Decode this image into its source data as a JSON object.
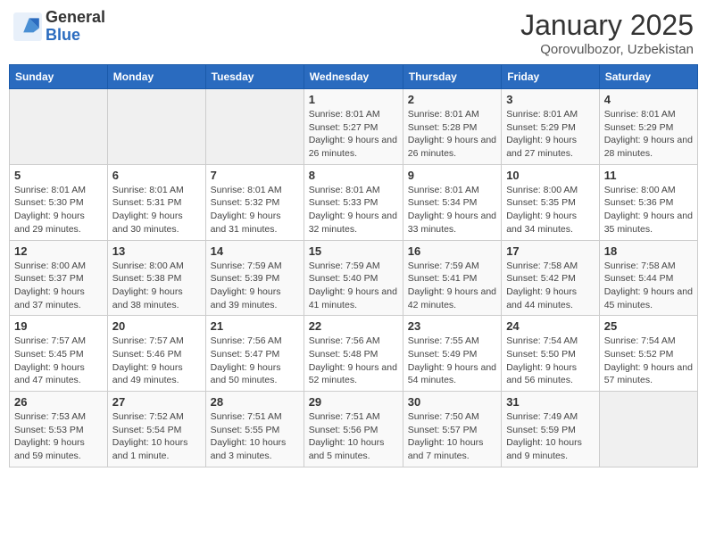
{
  "header": {
    "logo_general": "General",
    "logo_blue": "Blue",
    "month": "January 2025",
    "location": "Qorovulbozor, Uzbekistan"
  },
  "weekdays": [
    "Sunday",
    "Monday",
    "Tuesday",
    "Wednesday",
    "Thursday",
    "Friday",
    "Saturday"
  ],
  "weeks": [
    [
      {
        "day": "",
        "info": ""
      },
      {
        "day": "",
        "info": ""
      },
      {
        "day": "",
        "info": ""
      },
      {
        "day": "1",
        "info": "Sunrise: 8:01 AM\nSunset: 5:27 PM\nDaylight: 9 hours and 26 minutes."
      },
      {
        "day": "2",
        "info": "Sunrise: 8:01 AM\nSunset: 5:28 PM\nDaylight: 9 hours and 26 minutes."
      },
      {
        "day": "3",
        "info": "Sunrise: 8:01 AM\nSunset: 5:29 PM\nDaylight: 9 hours and 27 minutes."
      },
      {
        "day": "4",
        "info": "Sunrise: 8:01 AM\nSunset: 5:29 PM\nDaylight: 9 hours and 28 minutes."
      }
    ],
    [
      {
        "day": "5",
        "info": "Sunrise: 8:01 AM\nSunset: 5:30 PM\nDaylight: 9 hours and 29 minutes."
      },
      {
        "day": "6",
        "info": "Sunrise: 8:01 AM\nSunset: 5:31 PM\nDaylight: 9 hours and 30 minutes."
      },
      {
        "day": "7",
        "info": "Sunrise: 8:01 AM\nSunset: 5:32 PM\nDaylight: 9 hours and 31 minutes."
      },
      {
        "day": "8",
        "info": "Sunrise: 8:01 AM\nSunset: 5:33 PM\nDaylight: 9 hours and 32 minutes."
      },
      {
        "day": "9",
        "info": "Sunrise: 8:01 AM\nSunset: 5:34 PM\nDaylight: 9 hours and 33 minutes."
      },
      {
        "day": "10",
        "info": "Sunrise: 8:00 AM\nSunset: 5:35 PM\nDaylight: 9 hours and 34 minutes."
      },
      {
        "day": "11",
        "info": "Sunrise: 8:00 AM\nSunset: 5:36 PM\nDaylight: 9 hours and 35 minutes."
      }
    ],
    [
      {
        "day": "12",
        "info": "Sunrise: 8:00 AM\nSunset: 5:37 PM\nDaylight: 9 hours and 37 minutes."
      },
      {
        "day": "13",
        "info": "Sunrise: 8:00 AM\nSunset: 5:38 PM\nDaylight: 9 hours and 38 minutes."
      },
      {
        "day": "14",
        "info": "Sunrise: 7:59 AM\nSunset: 5:39 PM\nDaylight: 9 hours and 39 minutes."
      },
      {
        "day": "15",
        "info": "Sunrise: 7:59 AM\nSunset: 5:40 PM\nDaylight: 9 hours and 41 minutes."
      },
      {
        "day": "16",
        "info": "Sunrise: 7:59 AM\nSunset: 5:41 PM\nDaylight: 9 hours and 42 minutes."
      },
      {
        "day": "17",
        "info": "Sunrise: 7:58 AM\nSunset: 5:42 PM\nDaylight: 9 hours and 44 minutes."
      },
      {
        "day": "18",
        "info": "Sunrise: 7:58 AM\nSunset: 5:44 PM\nDaylight: 9 hours and 45 minutes."
      }
    ],
    [
      {
        "day": "19",
        "info": "Sunrise: 7:57 AM\nSunset: 5:45 PM\nDaylight: 9 hours and 47 minutes."
      },
      {
        "day": "20",
        "info": "Sunrise: 7:57 AM\nSunset: 5:46 PM\nDaylight: 9 hours and 49 minutes."
      },
      {
        "day": "21",
        "info": "Sunrise: 7:56 AM\nSunset: 5:47 PM\nDaylight: 9 hours and 50 minutes."
      },
      {
        "day": "22",
        "info": "Sunrise: 7:56 AM\nSunset: 5:48 PM\nDaylight: 9 hours and 52 minutes."
      },
      {
        "day": "23",
        "info": "Sunrise: 7:55 AM\nSunset: 5:49 PM\nDaylight: 9 hours and 54 minutes."
      },
      {
        "day": "24",
        "info": "Sunrise: 7:54 AM\nSunset: 5:50 PM\nDaylight: 9 hours and 56 minutes."
      },
      {
        "day": "25",
        "info": "Sunrise: 7:54 AM\nSunset: 5:52 PM\nDaylight: 9 hours and 57 minutes."
      }
    ],
    [
      {
        "day": "26",
        "info": "Sunrise: 7:53 AM\nSunset: 5:53 PM\nDaylight: 9 hours and 59 minutes."
      },
      {
        "day": "27",
        "info": "Sunrise: 7:52 AM\nSunset: 5:54 PM\nDaylight: 10 hours and 1 minute."
      },
      {
        "day": "28",
        "info": "Sunrise: 7:51 AM\nSunset: 5:55 PM\nDaylight: 10 hours and 3 minutes."
      },
      {
        "day": "29",
        "info": "Sunrise: 7:51 AM\nSunset: 5:56 PM\nDaylight: 10 hours and 5 minutes."
      },
      {
        "day": "30",
        "info": "Sunrise: 7:50 AM\nSunset: 5:57 PM\nDaylight: 10 hours and 7 minutes."
      },
      {
        "day": "31",
        "info": "Sunrise: 7:49 AM\nSunset: 5:59 PM\nDaylight: 10 hours and 9 minutes."
      },
      {
        "day": "",
        "info": ""
      }
    ]
  ]
}
